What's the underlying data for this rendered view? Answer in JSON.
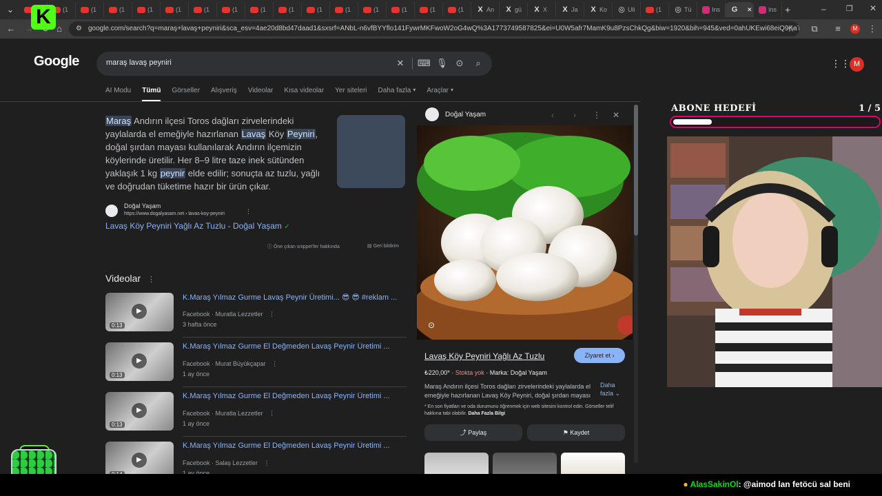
{
  "browser": {
    "tabs": [
      {
        "label": "(1",
        "icon": "youtube-icon"
      },
      {
        "label": "(1",
        "icon": "youtube-icon"
      },
      {
        "label": "(1",
        "icon": "youtube-icon"
      },
      {
        "label": "(1",
        "icon": "youtube-icon"
      },
      {
        "label": "(1",
        "icon": "youtube-icon"
      },
      {
        "label": "(1",
        "icon": "youtube-icon"
      },
      {
        "label": "(1",
        "icon": "youtube-icon"
      },
      {
        "label": "(1",
        "icon": "youtube-icon"
      },
      {
        "label": "(1",
        "icon": "youtube-icon"
      },
      {
        "label": "(1",
        "icon": "youtube-icon"
      },
      {
        "label": "(1",
        "icon": "youtube-icon"
      },
      {
        "label": "(1",
        "icon": "youtube-icon"
      },
      {
        "label": "(1",
        "icon": "youtube-icon"
      },
      {
        "label": "(1",
        "icon": "youtube-icon"
      },
      {
        "label": "(1",
        "icon": "youtube-icon"
      },
      {
        "label": "(1",
        "icon": "youtube-icon"
      },
      {
        "label": "An",
        "icon": "x-icon"
      },
      {
        "label": "gü",
        "icon": "x-icon"
      },
      {
        "label": "X",
        "icon": "x-icon"
      },
      {
        "label": "Ja",
        "icon": "x-icon"
      },
      {
        "label": "Ko",
        "icon": "x-icon"
      },
      {
        "label": "Uli",
        "icon": "globe-icon"
      },
      {
        "label": "(1",
        "icon": "youtube-icon"
      },
      {
        "label": "Tü",
        "icon": "globe-icon"
      },
      {
        "label": "Ins",
        "icon": "instagram-icon"
      },
      {
        "label": "",
        "icon": "google-icon"
      },
      {
        "label": "Ins",
        "icon": "instagram-icon"
      }
    ],
    "url": "google.com/search?q=maraş+lavaş+peyniri&sca_esv=4ae20d8bd47daad1&sxsrf=ANbL-n6vfBYYflo141FywrMKFwoW2oG4wQ%3A1773749587825&ei=U0W5afr7MamK9u8PzsChkQg&biw=1920&bih=945&ved=0ahUKEwi68eiQ9KaTAxUphf0H...",
    "profile_initial": "M"
  },
  "google": {
    "logo": "Google",
    "query": "maraş lavaş peyniri",
    "nav_tabs": [
      "AI Modu",
      "Tümü",
      "Görseller",
      "Alışveriş",
      "Videolar",
      "Kısa videolar",
      "Yer siteleri",
      "Daha fazla",
      "Araçlar"
    ],
    "active_tab": "Tümü"
  },
  "snippet": {
    "parts": [
      {
        "t": "Maraş",
        "hl": true
      },
      {
        "t": " Andırın ilçesi Toros dağları zirvelerindeki yaylalarda el emeğiyle hazırlanan ",
        "hl": false
      },
      {
        "t": "Lavaş",
        "hl": true
      },
      {
        "t": " Köy ",
        "hl": false
      },
      {
        "t": "Peyniri",
        "hl": true
      },
      {
        "t": ", doğal şırdan mayası kullanılarak Andırın ilçemizin köylerinde üretilir. Her 8–9 litre taze inek sütünden yaklaşık 1 kg ",
        "hl": false
      },
      {
        "t": "peynir",
        "hl": true
      },
      {
        "t": " elde edilir; sonuçta az tuzlu, yağlı ve doğrudan tüketime hazır bir ürün çıkar.",
        "hl": false
      }
    ],
    "source_name": "Doğal Yaşam",
    "source_url": "https://www.dogalyasam.net › lavas-koy-peyniri",
    "link_text": "Lavaş Köy Peyniri Yağlı Az Tuzlu - Doğal Yaşam",
    "about_label": "Öne çıkan snippet'ler hakkında",
    "feedback_label": "Geri bildirim"
  },
  "videos": {
    "title": "Videolar",
    "items": [
      {
        "title": "K.Maraş Yılmaz Gurme Lavaş Peynir Üretimi... 😎 😎 #reklam ...",
        "source": "Facebook · Muratla Lezzetler",
        "date": "3 hafta önce",
        "duration": "0:13"
      },
      {
        "title": "K.Maraş Yılmaz Gurme El Değmeden Lavaş Peynir Üretimi ...",
        "source": "Facebook · Murat Büyükçapar",
        "date": "1 ay önce",
        "duration": "0:13"
      },
      {
        "title": "K.Maraş Yılmaz Gurme El Değmeden Lavaş Peynir Üretimi ...",
        "source": "Facebook · Muratla Lezzetler",
        "date": "1 ay önce",
        "duration": "0:13"
      },
      {
        "title": "K.Maraş Yılmaz Gurme El Değmeden Lavaş Peynir Üretimi ...",
        "source": "Facebook · Salaş Lezzetler",
        "date": "1 ay önce",
        "duration": "0:14"
      }
    ]
  },
  "panel": {
    "source_name": "Doğal Yaşam",
    "product_title": "Lavaş Köy Peyniri Yağlı Az Tuzlu",
    "visit_label": "Ziyaret et ›",
    "price": "₺220,00*",
    "stock": "Stokta yok",
    "brand": "Marka: Doğal Yaşam",
    "description": "Maraş Andırın ilçesi Toros dağları zirvelerindeki yaylalarda el emeğiyle hazırlanan Lavaş Köy Peyniri, doğal şırdan mayası",
    "more_label": "Daha fazla",
    "note": "* En son fiyatları ve oda durumunu öğrenmek için web sitesini kontrol edin. Görseller telif hakkına tabi olabilir.",
    "note_link": "Daha Fazla Bilgi",
    "share_label": "Paylaş",
    "save_label": "Kaydet"
  },
  "overlay": {
    "goal_label": "ABONE HEDEFİ",
    "goal_count": "1 / 5",
    "goal_progress": 0.2,
    "chat_user": "AlasSakinOl",
    "chat_message": ": @aimod lan fetöcü sal beni",
    "colors": {
      "kick_green": "#53fc18",
      "goal_border": "#e0006f"
    }
  }
}
